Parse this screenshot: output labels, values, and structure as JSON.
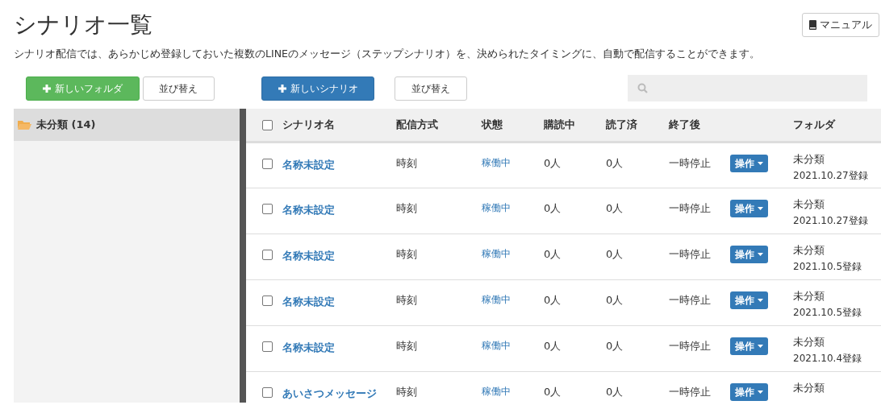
{
  "title": "シナリオ一覧",
  "manual_button": "マニュアル",
  "description": "シナリオ配信では、あらかじめ登録しておいた複数のLINEのメッセージ（ステップシナリオ）を、決められたタイミングに、自動で配信することができます。",
  "folder_toolbar": {
    "new_button": "新しいフォルダ",
    "sort_button": "並び替え"
  },
  "scenario_toolbar": {
    "new_button": "新しいシナリオ",
    "sort_button": "並び替え"
  },
  "folders": [
    {
      "label": "未分類 (14)",
      "selected": true
    }
  ],
  "table": {
    "select_all_checked": false,
    "columns": [
      "シナリオ名",
      "配信方式",
      "状態",
      "購読中",
      "読了済",
      "終了後",
      "フォルダ"
    ],
    "rows": [
      {
        "checked": false,
        "name": "名称未設定",
        "method": "時刻",
        "status": "稼働中",
        "subscribers": "0人",
        "read": "0人",
        "after_end": "一時停止",
        "action": "操作",
        "folder": "未分類",
        "registered": "2021.10.27登録"
      },
      {
        "checked": false,
        "name": "名称未設定",
        "method": "時刻",
        "status": "稼働中",
        "subscribers": "0人",
        "read": "0人",
        "after_end": "一時停止",
        "action": "操作",
        "folder": "未分類",
        "registered": "2021.10.27登録"
      },
      {
        "checked": false,
        "name": "名称未設定",
        "method": "時刻",
        "status": "稼働中",
        "subscribers": "0人",
        "read": "0人",
        "after_end": "一時停止",
        "action": "操作",
        "folder": "未分類",
        "registered": "2021.10.5登録"
      },
      {
        "checked": false,
        "name": "名称未設定",
        "method": "時刻",
        "status": "稼働中",
        "subscribers": "0人",
        "read": "0人",
        "after_end": "一時停止",
        "action": "操作",
        "folder": "未分類",
        "registered": "2021.10.5登録"
      },
      {
        "checked": false,
        "name": "名称未設定",
        "method": "時刻",
        "status": "稼働中",
        "subscribers": "0人",
        "read": "0人",
        "after_end": "一時停止",
        "action": "操作",
        "folder": "未分類",
        "registered": "2021.10.4登録"
      },
      {
        "checked": false,
        "name": "あいさつメッセージ",
        "method": "時刻",
        "status": "稼働中",
        "subscribers": "0人",
        "read": "0人",
        "after_end": "一時停止",
        "action": "操作",
        "folder": "未分類"
      }
    ]
  }
}
